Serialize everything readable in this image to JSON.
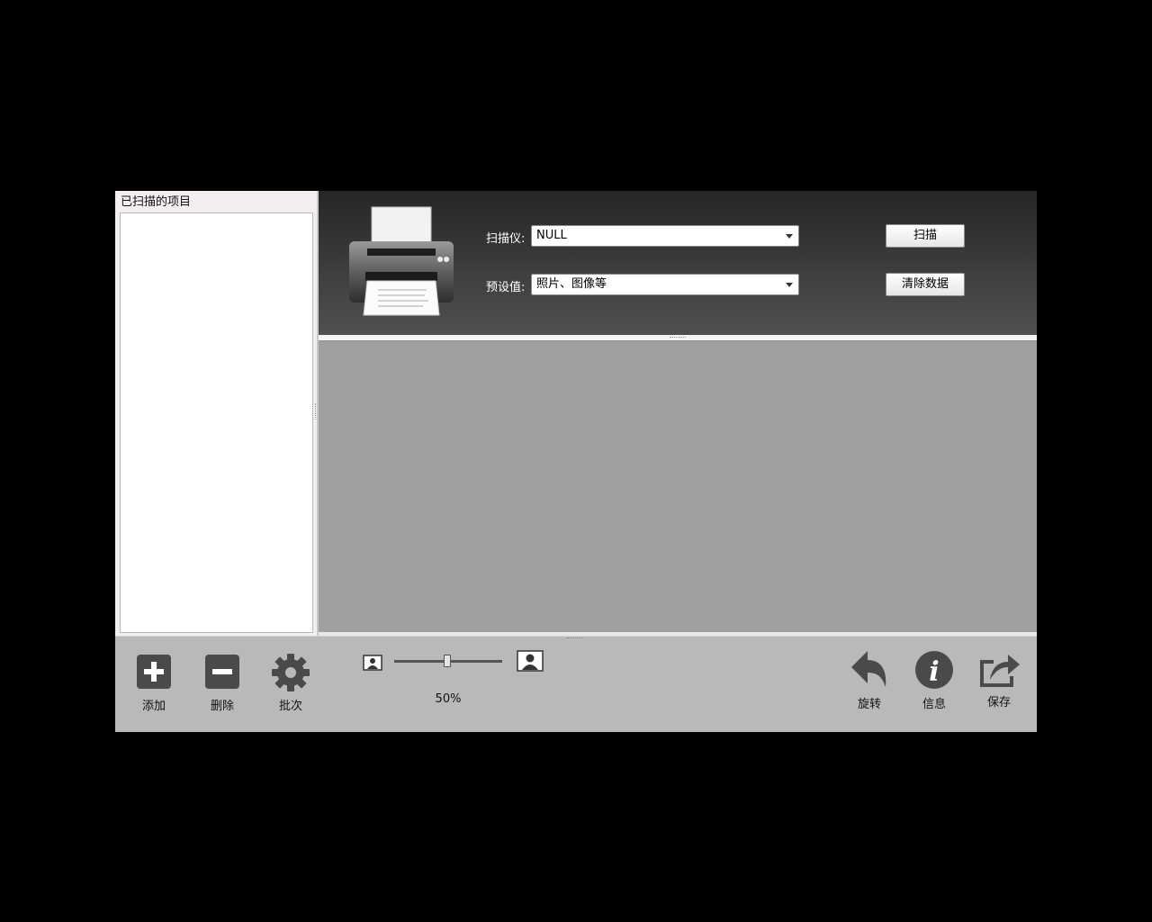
{
  "left_panel": {
    "title": "已扫描的项目"
  },
  "scanner": {
    "device_label": "扫描仪:",
    "device_value": "NULL",
    "preset_label": "预设值:",
    "preset_value": "照片、图像等",
    "scan_button": "扫描",
    "clear_button": "清除数据"
  },
  "toolbar": {
    "add_label": "添加",
    "delete_label": "删除",
    "batch_label": "批次",
    "zoom_value": "50%",
    "rotate_label": "旋转",
    "info_label": "信息",
    "save_label": "保存"
  },
  "icons": {
    "printer": "printer-icon",
    "add": "plus-square-icon",
    "delete": "minus-square-icon",
    "batch": "gear-icon",
    "zoom_out": "small-image-icon",
    "zoom_in": "large-image-icon",
    "rotate": "undo-arrow-icon",
    "info": "info-circle-icon",
    "save": "share-export-icon"
  },
  "colors": {
    "toolbar_icon": "#4a4a4a",
    "preview_bg": "#a0a0a0",
    "top_panel": "#3a3a3a"
  }
}
